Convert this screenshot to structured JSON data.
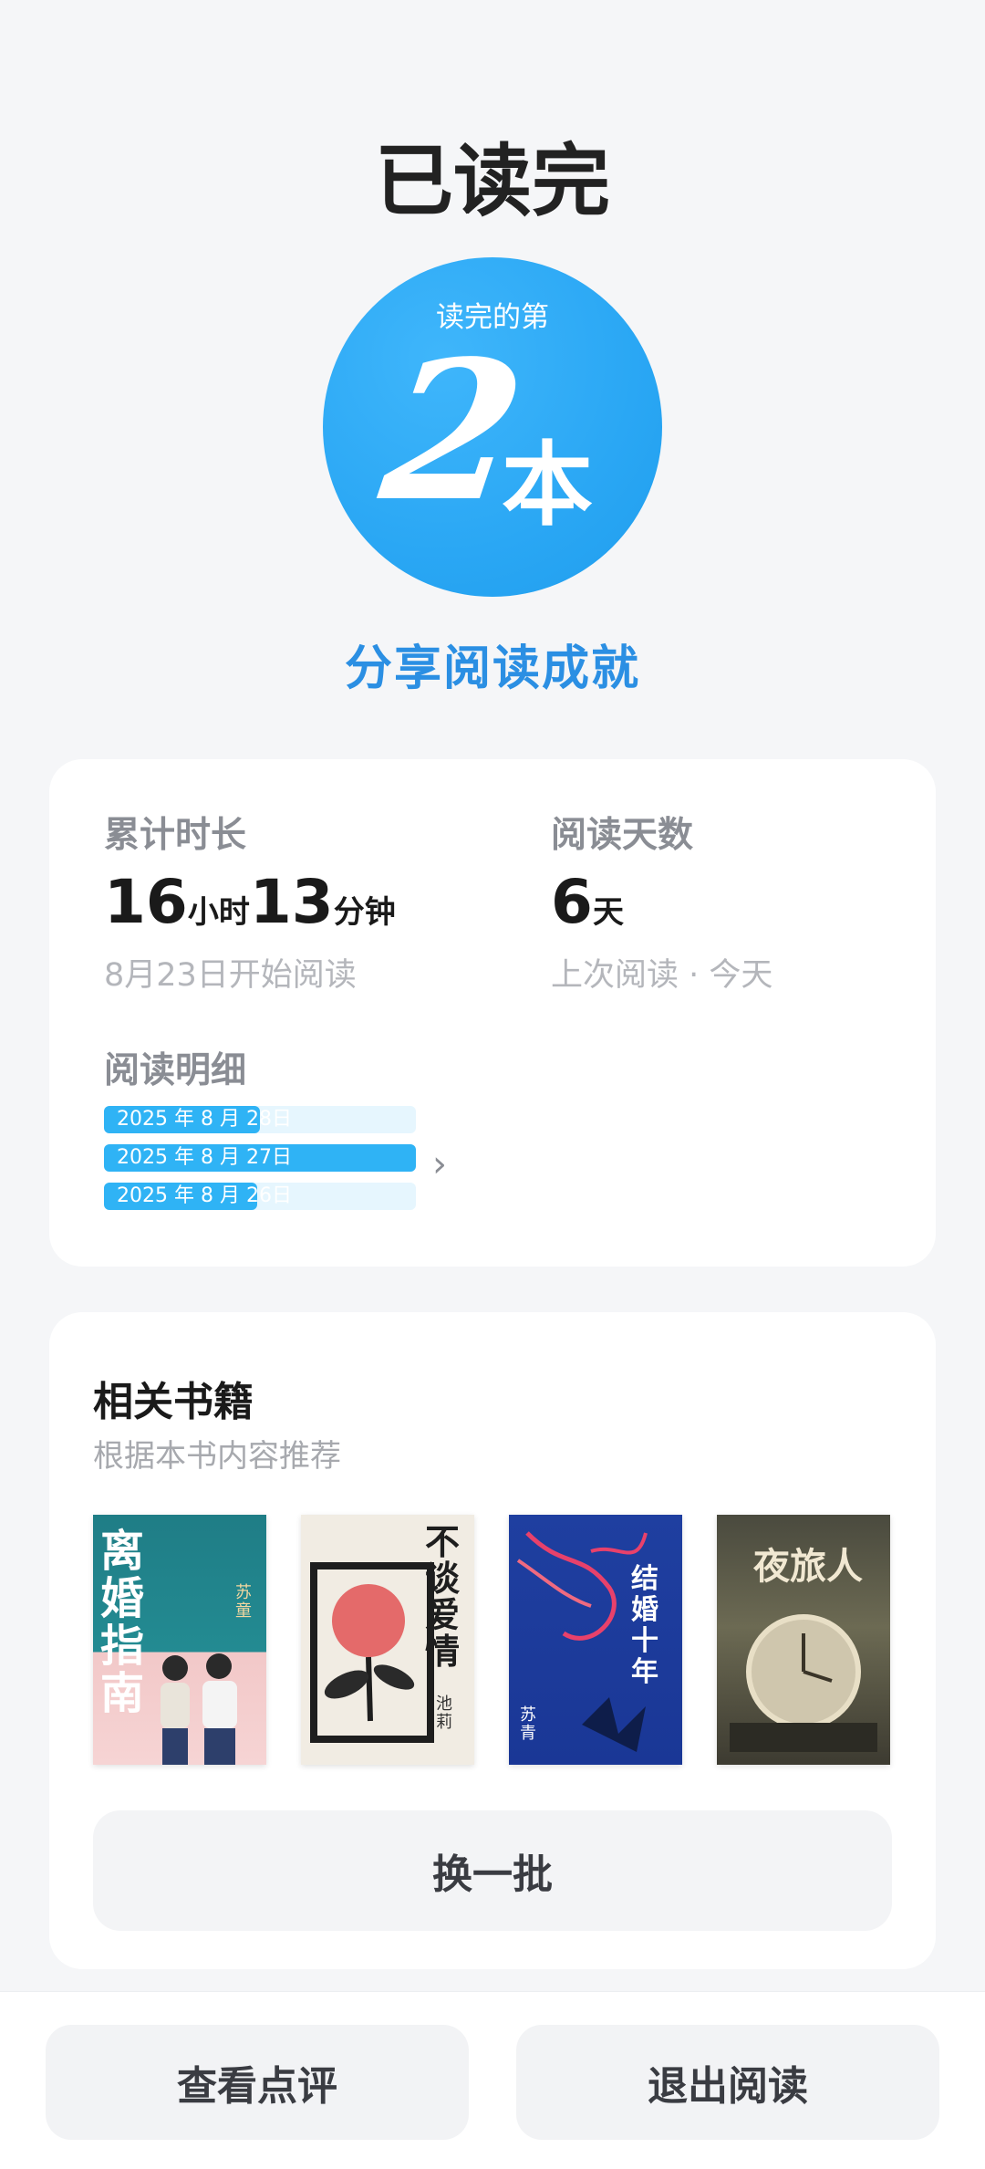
{
  "header": {
    "title": "已读完"
  },
  "badge": {
    "prefix": "读完的第",
    "number": "2",
    "unit": "本"
  },
  "share_label": "分享阅读成就",
  "stats": {
    "total_time_label": "累计时长",
    "hours": "16",
    "hours_unit": "小时",
    "minutes": "13",
    "minutes_unit": "分钟",
    "start_text": "8月23日开始阅读",
    "days_label": "阅读天数",
    "days": "6",
    "days_unit": "天",
    "last_read_text": "上次阅读 · 今天"
  },
  "details": {
    "label": "阅读明细",
    "rows": [
      {
        "date": "2025 年 8 月 28日",
        "fill": 0.5
      },
      {
        "date": "2025 年 8 月 27日",
        "fill": 1.0
      },
      {
        "date": "2025 年 8 月 26日",
        "fill": 0.49
      }
    ]
  },
  "related": {
    "title": "相关书籍",
    "subtitle": "根据本书内容推荐",
    "books": [
      {
        "title": "离婚指南",
        "author": "苏童"
      },
      {
        "title": "不谈爱情",
        "author": "池莉"
      },
      {
        "title": "结婚十年",
        "author": "苏青"
      },
      {
        "title": "夜旅人",
        "author": ""
      }
    ],
    "refresh_label": "换一批"
  },
  "bottom": {
    "review_label": "查看点评",
    "exit_label": "退出阅读"
  },
  "colors": {
    "accent": "#2b8fe3",
    "bar": "#2fb3f5"
  }
}
